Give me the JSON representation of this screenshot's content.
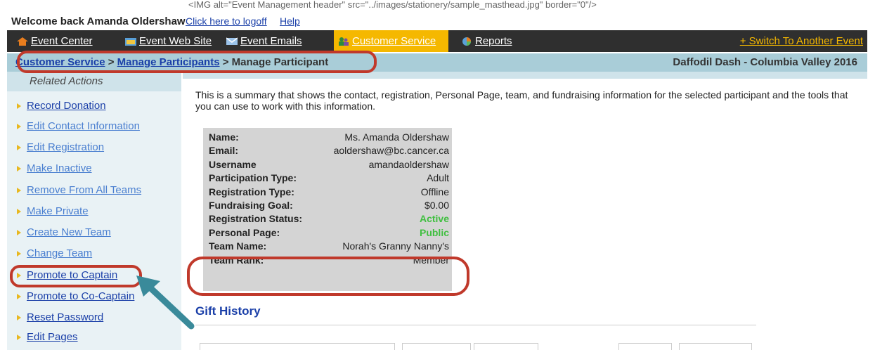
{
  "topbar": {
    "img_alt_text": "<IMG alt=\"Event Management header\" src=\"../images/stationery/sample_masthead.jpg\" border=\"0\"/>",
    "welcome": "Welcome back Amanda Oldershaw",
    "logoff": "Click here to logoff",
    "help": "Help"
  },
  "nav": {
    "items": [
      {
        "label": "Event Center",
        "icon": "home-icon"
      },
      {
        "label": "Event Web Site",
        "icon": "website-icon"
      },
      {
        "label": "Event Emails",
        "icon": "email-icon"
      },
      {
        "label": "Customer Service",
        "icon": "people-icon"
      },
      {
        "label": "Reports",
        "icon": "reports-icon"
      }
    ],
    "switch_event": "+ Switch To Another Event",
    "accent_color": "#f5b800"
  },
  "breadcrumb": {
    "part1": "Customer Service",
    "sep1": " > ",
    "part2": "Manage Participants",
    "sep2": " > ",
    "part3": "Manage Participant",
    "event_name": "Daffodil Dash - Columbia Valley 2016"
  },
  "sidebar": {
    "title": "Related Actions",
    "items": [
      {
        "label": "Record Donation"
      },
      {
        "label": "Edit Contact Information"
      },
      {
        "label": "Edit Registration"
      },
      {
        "label": "Make Inactive"
      },
      {
        "label": "Remove From All Teams"
      },
      {
        "label": "Make Private"
      },
      {
        "label": "Create New Team"
      },
      {
        "label": "Change Team"
      },
      {
        "label": "Promote to Captain"
      },
      {
        "label": "Promote to Co-Captain"
      },
      {
        "label": "Reset Password"
      },
      {
        "label": "Edit Pages"
      }
    ]
  },
  "main": {
    "intro": "This is a summary that shows the contact, registration, Personal Page, team, and fundraising information for the selected participant and the tools that you can use to work with this information.",
    "summary": [
      {
        "key": "Name:",
        "value": "Ms. Amanda Oldershaw"
      },
      {
        "key": "Email:",
        "value": "aoldershaw@bc.cancer.ca"
      },
      {
        "key": "Username",
        "value": "amandaoldershaw"
      },
      {
        "key": "Participation Type:",
        "value": "Adult"
      },
      {
        "key": "Registration Type:",
        "value": "Offline"
      },
      {
        "key": "Fundraising Goal:",
        "value": "$0.00"
      },
      {
        "key": "Registration Status:",
        "value": "Active"
      },
      {
        "key": "Personal Page:",
        "value": "Public"
      },
      {
        "key": "Team Name:",
        "value": "Norah's Granny Nanny's"
      },
      {
        "key": "Team Rank:",
        "value": "Member"
      }
    ],
    "gift_history_title": "Gift History"
  },
  "colors": {
    "annotation_ring": "#c0392b",
    "annotation_arrow": "#3a8a9a",
    "status_green": "#3fbf3f"
  }
}
